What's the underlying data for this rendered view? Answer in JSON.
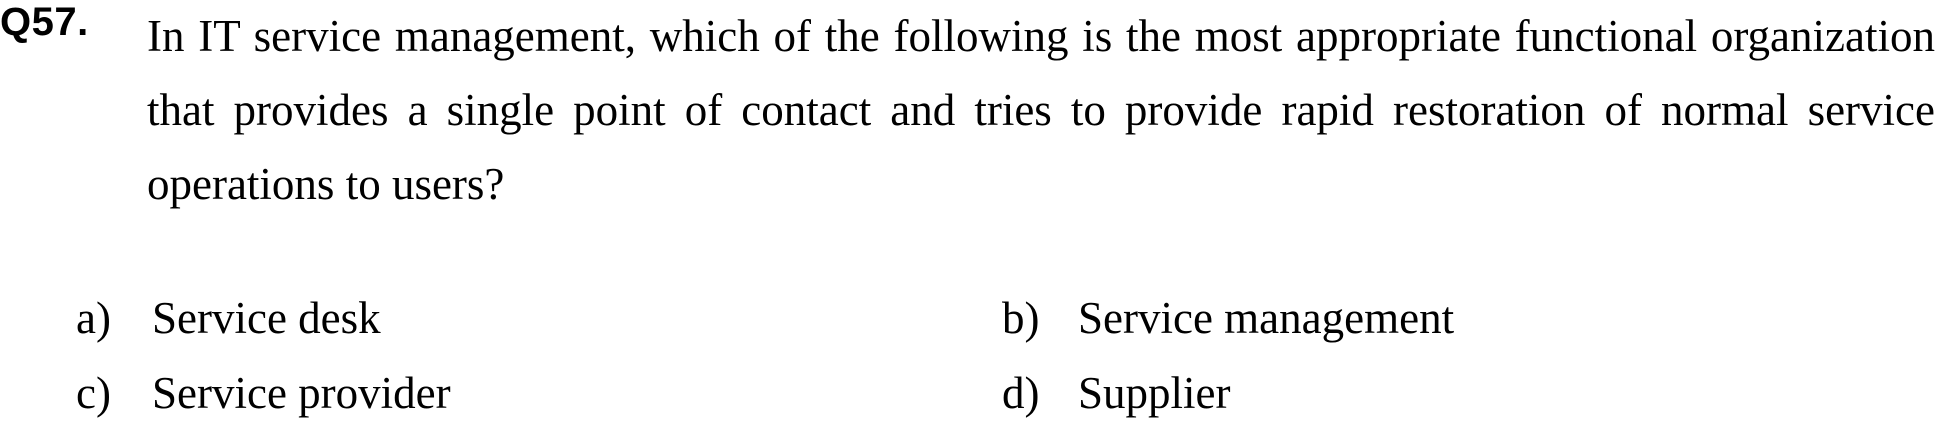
{
  "question": {
    "number": "Q57.",
    "text": "In IT service management, which of the following is the most appropriate functional organization that provides a single point of contact and tries to provide rapid restoration of normal service operations to users?"
  },
  "options": [
    {
      "letter": "a)",
      "text": "Service desk"
    },
    {
      "letter": "b)",
      "text": "Service management"
    },
    {
      "letter": "c)",
      "text": "Service provider"
    },
    {
      "letter": "d)",
      "text": "Supplier"
    }
  ]
}
